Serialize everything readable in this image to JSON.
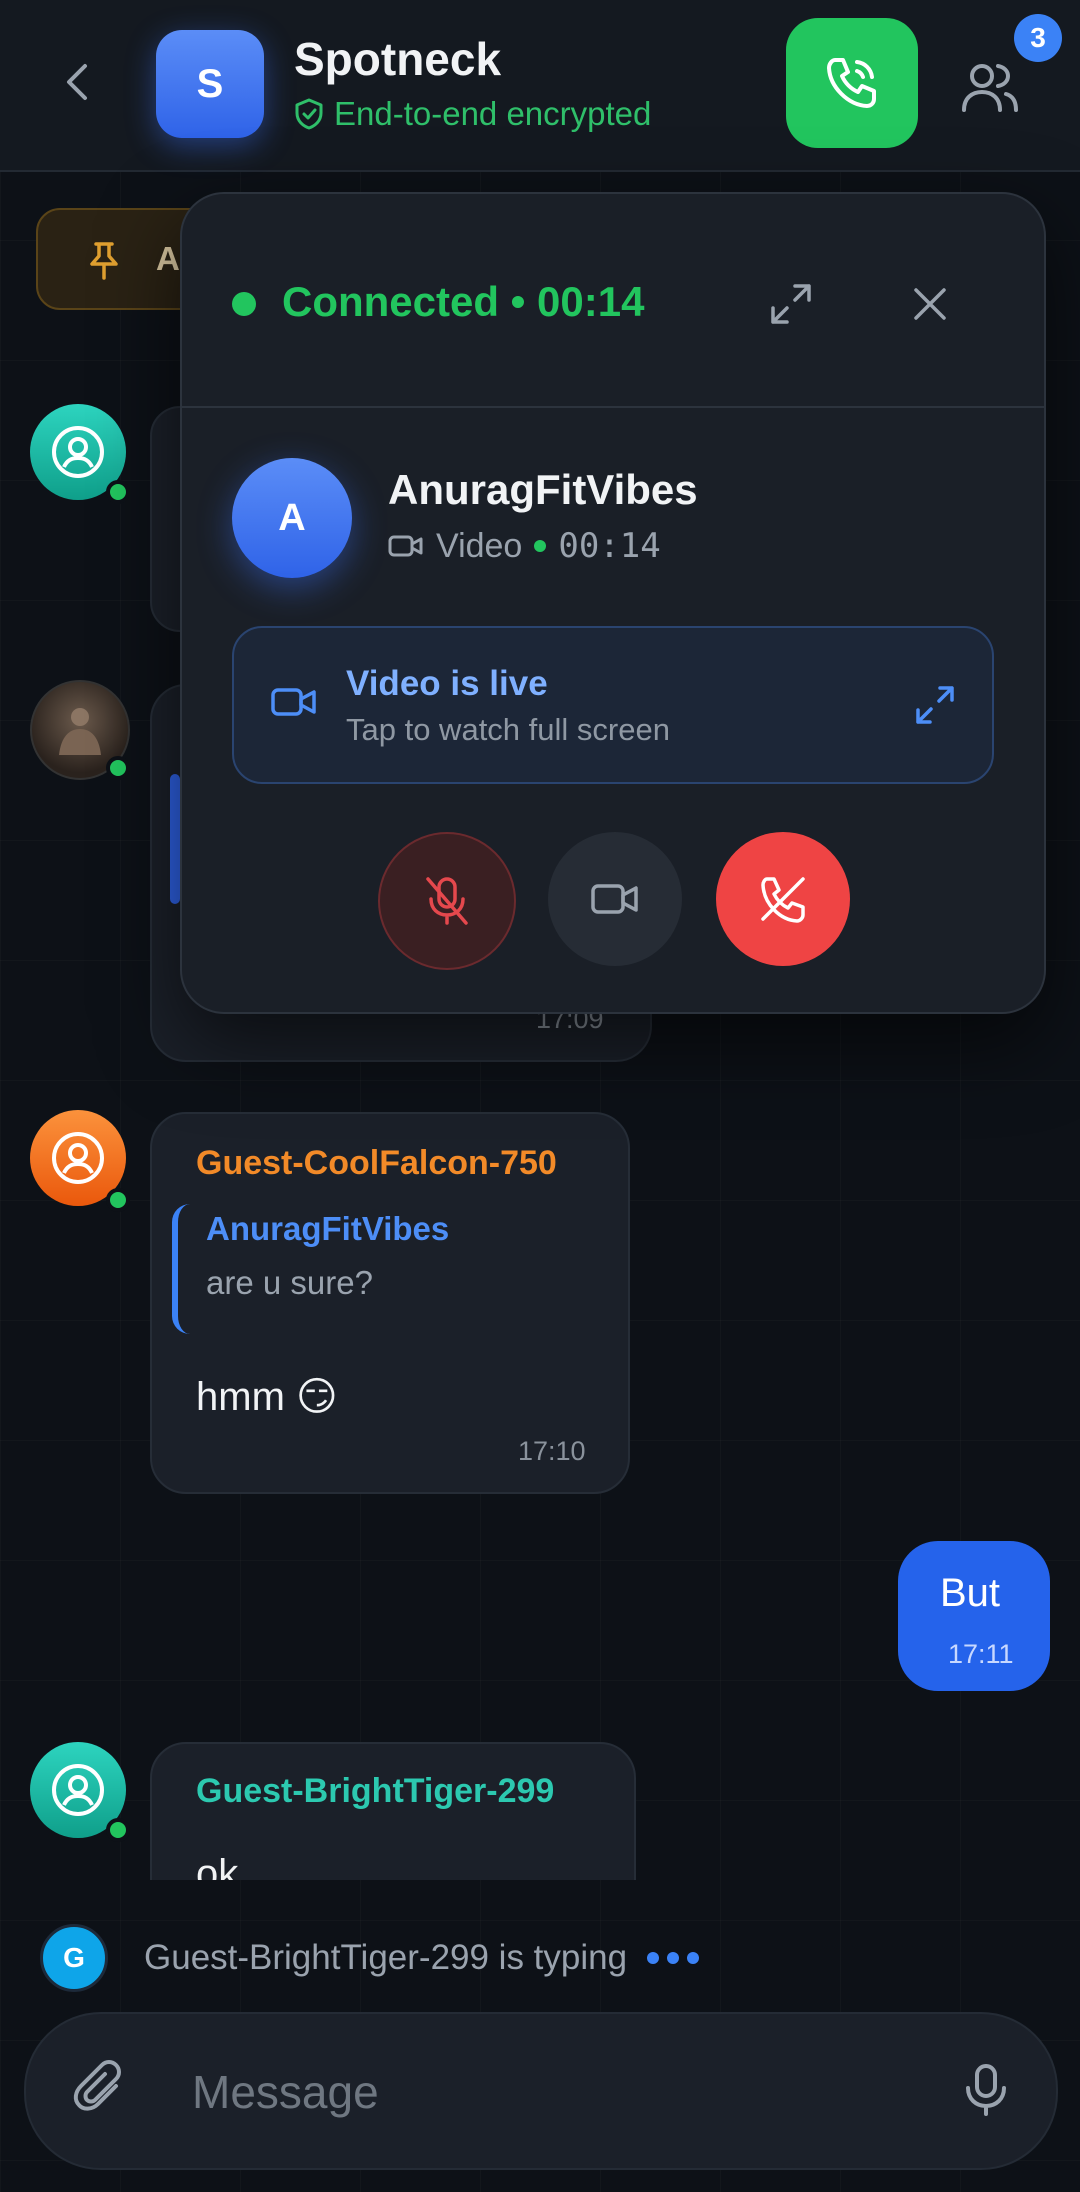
{
  "header": {
    "avatar_letter": "S",
    "title": "Spotneck",
    "subtitle": "End-to-end encrypted",
    "participants_badge": "3"
  },
  "pinned": {
    "label": "Ar"
  },
  "messages": [
    {
      "sender": "Guest-CoolFalcon-750",
      "sender_color": "#f28a28",
      "reply_to": {
        "name": "AnuragFitVibes",
        "text": "are u sure?"
      },
      "text": "hmm 😏",
      "time": "17:10"
    },
    {
      "mine": true,
      "text": "But",
      "time": "17:11"
    },
    {
      "sender": "Guest-BrightTiger-299",
      "sender_color": "#2cc9b0",
      "text": "ok"
    }
  ],
  "hidden_time": "17:09",
  "call_panel": {
    "status": "Connected • 00:14",
    "callee_letter": "A",
    "callee_name": "AnuragFitVibes",
    "call_type": "Video",
    "duration": "00:14",
    "live_title": "Video is live",
    "live_subtitle": "Tap to watch full screen"
  },
  "typing": {
    "avatar_letter": "G",
    "text": "Guest-BrightTiger-299 is typing"
  },
  "composer": {
    "placeholder": "Message"
  },
  "colors": {
    "accent": "#3b82f6",
    "online": "#22c55e",
    "end_call": "#ef4444",
    "my_bubble": "#2563eb"
  }
}
